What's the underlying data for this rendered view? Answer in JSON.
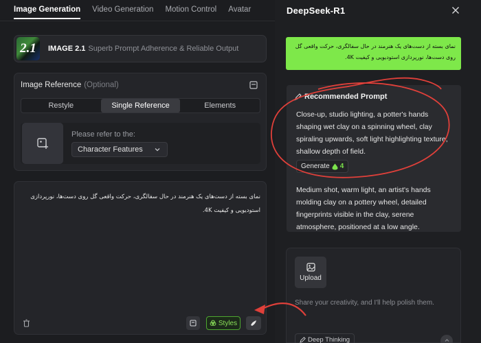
{
  "nav": {
    "tabs": [
      {
        "label": "Image Generation",
        "active": true
      },
      {
        "label": "Video Generation",
        "active": false
      },
      {
        "label": "Motion Control",
        "active": false
      },
      {
        "label": "Avatar",
        "active": false
      }
    ]
  },
  "model": {
    "logo_text": "2.1",
    "name": "IMAGE 2.1",
    "description": "Superb Prompt Adherence & Reliable Output"
  },
  "image_reference": {
    "title": "Image Reference",
    "optional": "(Optional)",
    "modes": [
      "Restyle",
      "Single Reference",
      "Elements"
    ],
    "active_mode": "Single Reference",
    "refer_label": "Please refer to the:",
    "selected": "Character Features"
  },
  "prompt": {
    "text": "نمای بسته از دست‌های یک هنرمند در حال سفالگری، حرکت واقعی گل روی دست‌ها، نورپردازی استودیویی و کیفیت 4K."
  },
  "toolbar": {
    "styles_label": "Styles"
  },
  "assistant": {
    "title": "DeepSeek-R1",
    "user_message": "نمای بسته از دست‌های یک هنرمند در حال سفالگری، حرکت واقعی گل روی دست‌ها، نورپردازی استودیویی و کیفیت 4K.",
    "recommended": {
      "heading": "Recommended Prompt",
      "prompt_1": "Close-up, studio lighting, a potter's hands shaping wet clay on a spinning wheel, clay spiraling upwards, soft light highlighting texture, shallow depth of field.",
      "generate_label": "Generate",
      "generate_credits": "4",
      "prompt_2": "Medium shot, warm light, an artist's hands molding clay on a pottery wheel, detailed fingerprints visible in the clay, serene atmosphere, positioned at a low angle."
    },
    "upload_label": "Upload",
    "input_placeholder": "Share your creativity, and I'll help polish them.",
    "deep_thinking_label": "Deep Thinking"
  },
  "colors": {
    "accent_green": "#7ee84a",
    "annotation_red": "#e0403a"
  }
}
